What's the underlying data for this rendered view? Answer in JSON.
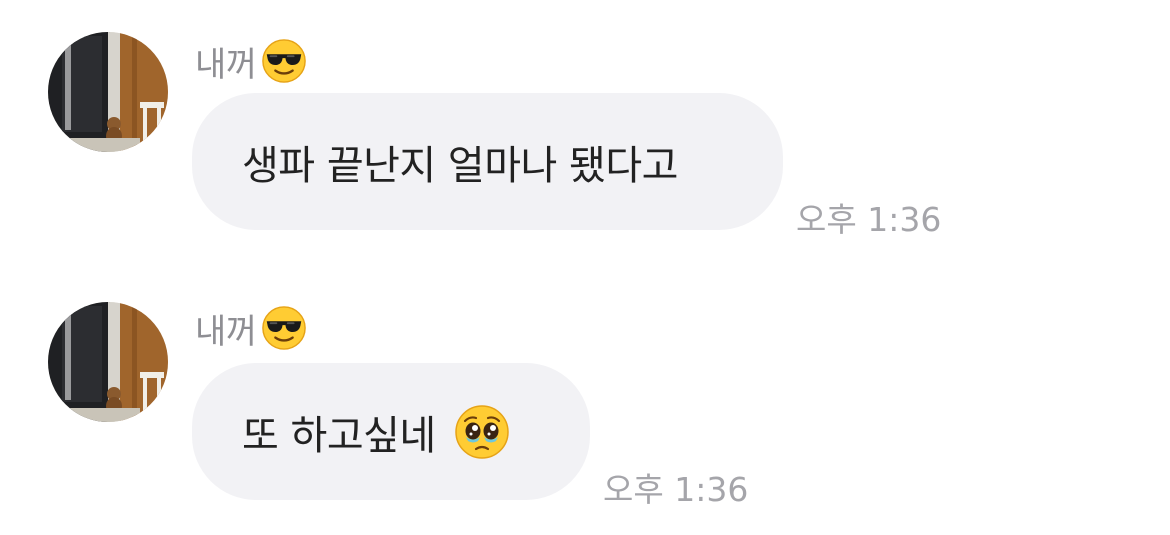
{
  "messages": [
    {
      "sender": "내꺼",
      "sender_emoji": "smiling-face-with-sunglasses",
      "text": "생파 끝난지 얼마나 됐다고",
      "text_emoji": null,
      "time": "오후 1:36"
    },
    {
      "sender": "내꺼",
      "sender_emoji": "smiling-face-with-sunglasses",
      "text": "또 하고싶네",
      "text_emoji": "pleading-face",
      "time": "오후 1:36"
    }
  ],
  "colors": {
    "bubble": "#f2f2f5",
    "message_text": "#222222",
    "sender_name": "#8e8e93",
    "timestamp": "#a5a5aa"
  }
}
